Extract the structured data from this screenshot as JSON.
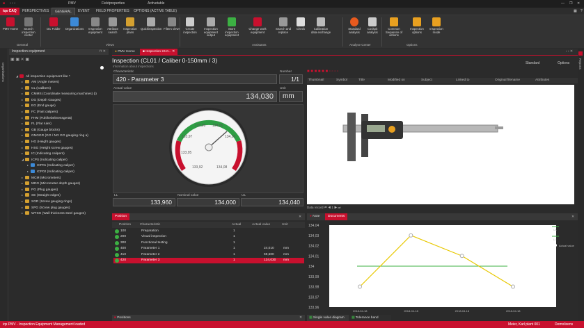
{
  "title_bar": {
    "app_tab": "PMV",
    "field_tab": "Fieldproperties",
    "active_tab": "Activetable",
    "close": "✕",
    "max": "❐",
    "min": "—"
  },
  "ribbon_tabs": {
    "app": "iqs CAQ",
    "tabs": [
      "PERSPECTIVES",
      "GENERAL",
      "EVENT",
      "FIELD PROPERTIES",
      "OPTIONS (ACTIVE TABLE)"
    ]
  },
  "ribbon": {
    "buttons": [
      "PMV Home",
      "Search inspection center",
      "DC Folder",
      "Organizations",
      "Inspection equipment",
      "Attribute search",
      "Inspection plans",
      "Quickinspection",
      "Filters views",
      "Create inspection",
      "Inspection equipment output",
      "Store inspection equipment",
      "Change work equipment",
      "Search and replace",
      "Check",
      "Calibration data exchange",
      "Standard analysis",
      "Cockpit analysis",
      "Common Sequence of actions",
      "Inspection options",
      "Inspection mode"
    ],
    "groups": [
      "General",
      "Views",
      "Assistants",
      "Analyse Center",
      "Options"
    ],
    "colors": {
      "accent": "#c8102e"
    }
  },
  "left_strip": {
    "label": "Organisations"
  },
  "right_strip": {
    "label": "Reports"
  },
  "tree": {
    "title": "Inspection equipment",
    "root": "All inspection equipment like *",
    "items": [
      "AM (Angle meters)",
      "CL (Calibers)",
      "CMMS (Coordinate measuring machines) (i)",
      "DG (Depth Gauges)",
      "EG (End gauge)",
      "FC (Fast calipers)",
      "FHM (Fühlhebelmessgerät)",
      "FL (Flat ruler)",
      "GB (Gauge blocks)",
      "GNGGR (GO / NO GO gauging ring a)",
      "HG (Height gauges)",
      "HSG (Height screw gauges)",
      "IC (Indicating calipers)",
      "ICPS (Indicating caliper)",
      "ICP01 (Indicating caliper)",
      "ICP02 (Indicating caliper)",
      "MCM (Micrometers)",
      "MDG (Micrometer depth gauges)",
      "PG (Plug gauges)",
      "SE (Straight edges)",
      "SGR (Screw gauging rings)",
      "SPG (Screw plug gauges)",
      "WTSG (Wall thickness steel gauges)"
    ]
  },
  "doc_tabs": {
    "home": "PMV Home",
    "insp": "Inspection 24.0..."
  },
  "inspection": {
    "title": "Inspection (CL01 / Caliber 0-150mm / 3)",
    "subtitle": "Information about inspections",
    "char_label": "Characteristic",
    "char_value": "420 - Parameter 3",
    "number_label": "Number",
    "number_value": "1/1",
    "actual_label": "Actual value",
    "actual_value": "134,030",
    "unit_label": "Unit",
    "unit_value": "mm",
    "ll_label": "LL",
    "ll_value": "133,960",
    "nominal_label": "Nominal value",
    "nominal_value": "134,000",
    "ul_label": "UL",
    "ul_value": "134,040",
    "gauge_ticks": [
      "133,99",
      "134,01",
      "133,97",
      "134,03",
      "133,95",
      "133,93",
      "134,07",
      "133,92",
      "134,08"
    ]
  },
  "image_panel": {
    "layout": "Standard",
    "options": "Options",
    "columns": [
      "Thumbnail",
      "Symbol",
      "Title",
      "Modified on",
      "Subject",
      "Linked to",
      "Original filename",
      "Attributes"
    ],
    "record_label": "Data record",
    "record_value": "1"
  },
  "positions": {
    "title": "Position",
    "columns": [
      "Position",
      "Characteristic",
      "Actual",
      "Actual value",
      "Unit"
    ],
    "rows": [
      {
        "pos": "100",
        "char": "Preparation",
        "num": "1",
        "val": "",
        "unit": ""
      },
      {
        "pos": "200",
        "char": "Visual inspection",
        "num": "1",
        "val": "",
        "unit": ""
      },
      {
        "pos": "300",
        "char": "Functional testing",
        "num": "1",
        "val": "",
        "unit": ""
      },
      {
        "pos": "400",
        "char": "Parameter 1",
        "num": "1",
        "val": "24,010",
        "unit": "mm"
      },
      {
        "pos": "410",
        "char": "Parameter 2",
        "num": "1",
        "val": "59,500",
        "unit": "mm"
      },
      {
        "pos": "420",
        "char": "Parameter 3",
        "num": "1",
        "val": "134,030",
        "unit": "mm"
      }
    ],
    "bottom_tab": "Positions"
  },
  "chart_panel": {
    "tab_note": "Note",
    "tab_docs": "Documents",
    "bottom_tab1": "Single value diagram",
    "bottom_tab2": "Tolerance band",
    "legend": [
      "UL",
      "LL",
      "Actual value"
    ]
  },
  "chart_data": {
    "type": "line",
    "x": [
      "2018-04-18",
      "2018-04-18",
      "2018-04-18",
      "2018-04-18"
    ],
    "series": [
      {
        "name": "Actual value",
        "values": [
          133.98,
          134.03,
          134.01,
          133.98
        ]
      },
      {
        "name": "UL",
        "values": [
          134.04,
          134.04,
          134.04,
          134.04
        ]
      },
      {
        "name": "LL",
        "values": [
          133.96,
          133.96,
          133.96,
          133.96
        ]
      }
    ],
    "nominal": 134.0,
    "yticks": [
      "134,04",
      "134,03",
      "134,02",
      "134,01",
      "134",
      "133,99",
      "133,98",
      "133,97",
      "133,96"
    ],
    "ylim": [
      133.96,
      134.04
    ],
    "legend_position": "top-right",
    "colors": {
      "actual": "#e8c800",
      "nominal": "#3cb043",
      "band": "#ffffff"
    }
  },
  "status": {
    "left": "iqs PMV - Inspection Equipment Management loaded",
    "right": "Meier, Karl  plant 001",
    "far": "Demolizens"
  }
}
